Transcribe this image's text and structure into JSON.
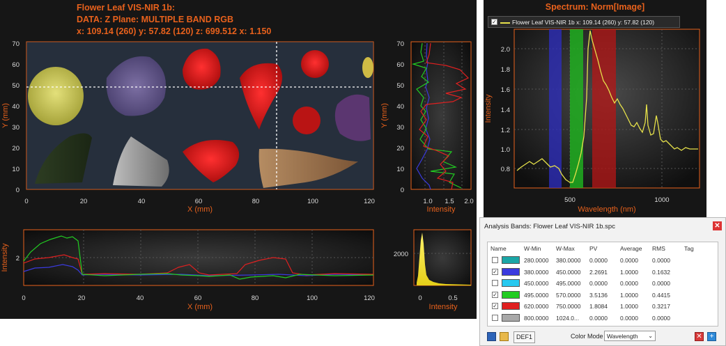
{
  "left_header": {
    "title": "Flower Leaf VIS-NIR 1b:",
    "data_line": "DATA: Z Plane: MULTIPLE BAND RGB",
    "coords_line": "x: 109.14 (260)  y:  57.82 (120)  z: 699.512  x:  1.150"
  },
  "image_plot": {
    "y_ticks": [
      "70",
      "60",
      "50",
      "40",
      "30",
      "20",
      "10",
      "0"
    ],
    "x_ticks": [
      "0",
      "20",
      "40",
      "60",
      "80",
      "100",
      "120"
    ],
    "x_label": "X (mm)",
    "y_label": "Y (mm)"
  },
  "vertical_profile": {
    "y_ticks": [
      "70",
      "60",
      "50",
      "40",
      "30",
      "20",
      "10",
      "0"
    ],
    "x_ticks": [
      "1.0",
      "1.5",
      "2.0"
    ],
    "x_label": "Intensity",
    "y_label": "Y (mm)"
  },
  "horizontal_profile": {
    "y_ticks": [
      "2"
    ],
    "x_ticks": [
      "0",
      "20",
      "40",
      "60",
      "80",
      "100",
      "120"
    ],
    "x_label": "X (mm)",
    "y_label": "Intensity"
  },
  "histogram": {
    "y_ticks": [
      "2000"
    ],
    "x_ticks": [
      "0",
      "0.5"
    ],
    "x_label": "Intensity"
  },
  "spectrum": {
    "title": "Spectrum: Norm[Image]",
    "legend_label": "Flower Leaf VIS-NIR 1b x: 109.14 (260)  y: 57.82 (120)",
    "x_label": "Wavelength (nm)",
    "y_label": "Intensity",
    "x_ticks": [
      "500",
      "1000"
    ],
    "y_ticks": [
      "2.0",
      "1.8",
      "1.6",
      "1.4",
      "1.2",
      "1.0",
      "0.8"
    ],
    "line_color": "#e6e14a"
  },
  "bands_dialog": {
    "title": "Analysis Bands: Flower Leaf VIS-NIR 1b.spc",
    "columns": [
      "Name",
      "W-Min",
      "W-Max",
      "PV",
      "Average",
      "RMS",
      "Tag"
    ],
    "rows": [
      {
        "checked": false,
        "color": "#1aa6a6",
        "wmin": "280.0000",
        "wmax": "380.0000",
        "pv": "0.0000",
        "average": "0.0000",
        "rms": "0.0000"
      },
      {
        "checked": true,
        "color": "#3a3adf",
        "wmin": "380.0000",
        "wmax": "450.0000",
        "pv": "2.2691",
        "average": "1.0000",
        "rms": "0.1632"
      },
      {
        "checked": false,
        "color": "#27c9f0",
        "wmin": "450.0000",
        "wmax": "495.0000",
        "pv": "0.0000",
        "average": "0.0000",
        "rms": "0.0000"
      },
      {
        "checked": true,
        "color": "#22cc22",
        "wmin": "495.0000",
        "wmax": "570.0000",
        "pv": "3.5136",
        "average": "1.0000",
        "rms": "0.4415"
      },
      {
        "checked": true,
        "color": "#e02020",
        "wmin": "620.0000",
        "wmax": "750.0000",
        "pv": "1.8084",
        "average": "1.0000",
        "rms": "0.3217"
      },
      {
        "checked": false,
        "color": "#a8a8a8",
        "wmin": "800.0000",
        "wmax": "1024.0...",
        "pv": "0.0000",
        "average": "0.0000",
        "rms": "0.0000"
      }
    ],
    "def_button": "DEF1",
    "color_mode_label": "Color Mode",
    "color_mode_value": "Wavelength"
  }
}
